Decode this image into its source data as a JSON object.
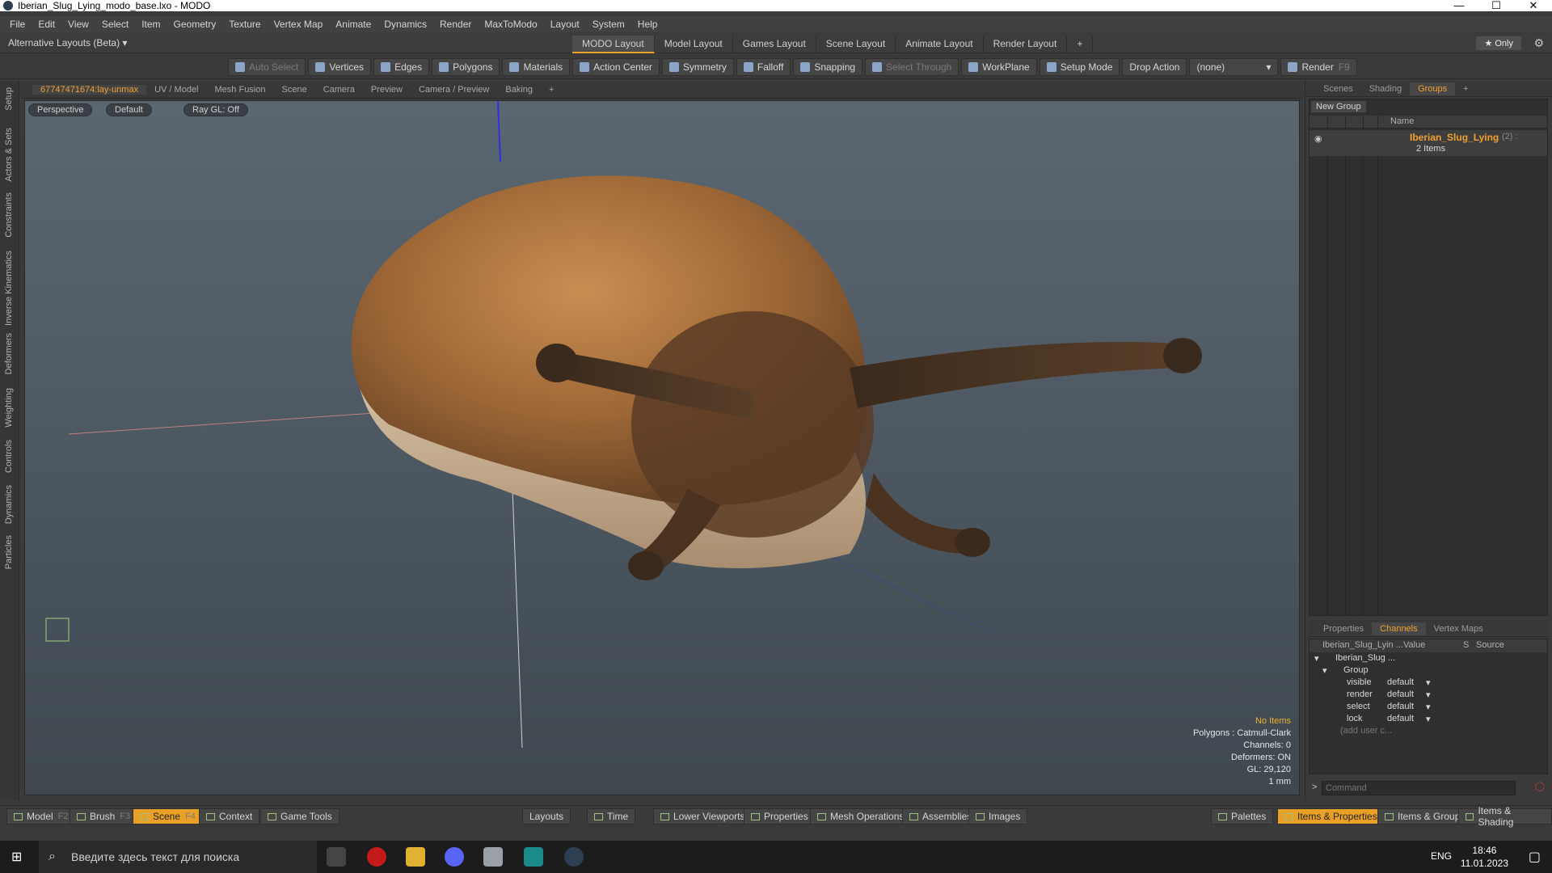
{
  "window": {
    "title": "Iberian_Slug_Lying_modo_base.lxo - MODO"
  },
  "menu": [
    "File",
    "Edit",
    "View",
    "Select",
    "Item",
    "Geometry",
    "Texture",
    "Vertex Map",
    "Animate",
    "Dynamics",
    "Render",
    "MaxToModo",
    "Layout",
    "System",
    "Help"
  ],
  "layouts": {
    "alt": "Alternative Layouts (Beta) ▾",
    "tabs": [
      "MODO Layout",
      "Model Layout",
      "Games Layout",
      "Scene Layout",
      "Animate Layout",
      "Render Layout"
    ],
    "active_tab": "MODO Layout",
    "only": "★  Only"
  },
  "toolbar": {
    "auto_select": "Auto Select",
    "vertices": "Vertices",
    "edges": "Edges",
    "polygons": "Polygons",
    "materials": "Materials",
    "action_center": "Action Center",
    "symmetry": "Symmetry",
    "falloff": "Falloff",
    "snapping": "Snapping",
    "select_through": "Select Through",
    "workplane": "WorkPlane",
    "setup_mode": "Setup Mode",
    "drop_action": "Drop Action",
    "drop_value": "(none)",
    "render": "Render",
    "render_key": "F9"
  },
  "left_strip": [
    "Setup",
    "Actors & Sets",
    "Constraints",
    "Inverse Kinematics",
    "Deformers",
    "Weighting",
    "Controls",
    "Dynamics",
    "Particles"
  ],
  "viewport_tabs": [
    "67747471674:lay-unmax",
    "UV / Model",
    "Mesh Fusion",
    "Scene",
    "Camera",
    "Preview",
    "Camera / Preview",
    "Baking"
  ],
  "viewport": {
    "view": "Perspective",
    "shading": "Default",
    "raygl": "Ray GL: Off",
    "info": {
      "items": "No Items",
      "polygons": "Polygons : Catmull-Clark",
      "channels": "Channels: 0",
      "deformers": "Deformers: ON",
      "gl": "GL: 29,120",
      "unit": "1 mm"
    }
  },
  "right_tabs": [
    "Scenes",
    "Shading",
    "Groups"
  ],
  "groups": {
    "new_group": "New Group",
    "col_name": "Name",
    "item_name": "Iberian_Slug_Lying",
    "item_suffix": "(2) :",
    "item_count": "2 Items"
  },
  "channels_tabs": [
    "Properties",
    "Channels",
    "Vertex Maps"
  ],
  "channels": {
    "headers": [
      "Iberian_Slug_Lyin ...",
      "Value",
      "S",
      "Source"
    ],
    "tree_item": "Iberian_Slug ...",
    "group": "Group",
    "rows": [
      {
        "name": "visible",
        "value": "default"
      },
      {
        "name": "render",
        "value": "default"
      },
      {
        "name": "select",
        "value": "default"
      },
      {
        "name": "lock",
        "value": "default"
      }
    ],
    "add_user": "(add user c..."
  },
  "command_placeholder": "Command",
  "bottom": {
    "model": "Model",
    "model_key": "F2",
    "brush": "Brush",
    "brush_key": "F3",
    "scene": "Scene",
    "scene_key": "F4",
    "context": "Context",
    "game_tools": "Game Tools",
    "layouts": "Layouts",
    "time": "Time",
    "lower_viewports": "Lower Viewports",
    "properties": "Properties",
    "mesh_operations": "Mesh Operations",
    "assemblies": "Assemblies",
    "images": "Images",
    "palettes": "Palettes",
    "items_properties": "Items & Properties",
    "items_groups": "Items & Groups",
    "items_shading": "Items & Shading"
  },
  "taskbar": {
    "search": "Введите здесь текст для поиска",
    "lang": "ENG",
    "time": "18:46",
    "date": "11.01.2023"
  },
  "colors": {
    "accent": "#e8a126",
    "bg": "#3a3a3a"
  }
}
